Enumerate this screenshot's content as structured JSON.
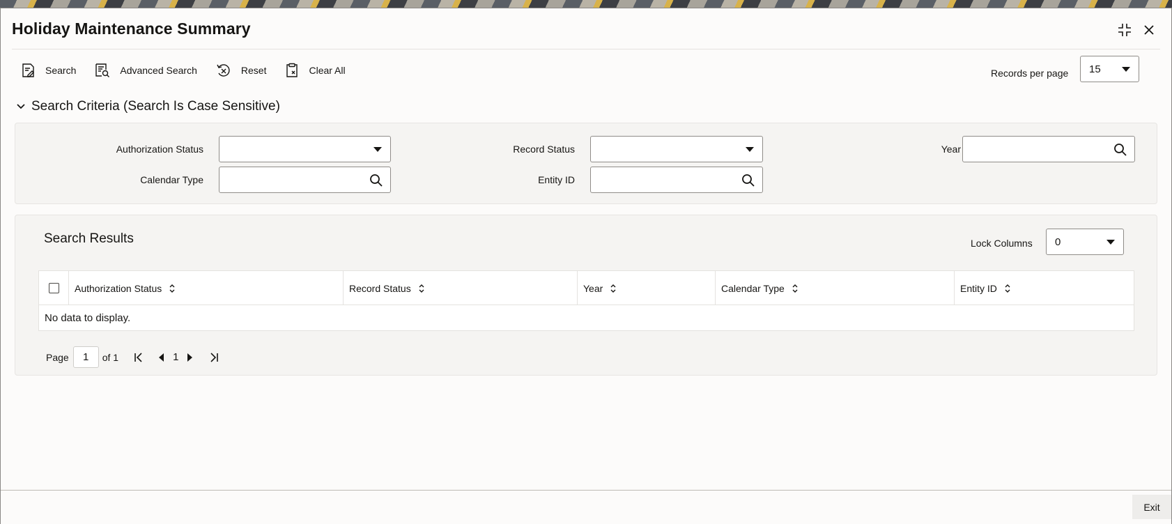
{
  "window": {
    "title": "Holiday Maintenance Summary"
  },
  "toolbar": {
    "search_label": "Search",
    "advanced_search_label": "Advanced Search",
    "reset_label": "Reset",
    "clear_all_label": "Clear All",
    "records_per_page_label": "Records per page",
    "records_per_page_value": "15"
  },
  "criteria": {
    "header": "Search Criteria (Search Is Case Sensitive)",
    "authorization_status_label": "Authorization Status",
    "authorization_status_value": "",
    "record_status_label": "Record Status",
    "record_status_value": "",
    "year_label": "Year",
    "calendar_type_label": "Calendar Type",
    "entity_id_label": "Entity ID"
  },
  "results": {
    "title": "Search Results",
    "lock_columns_label": "Lock Columns",
    "lock_columns_value": "0",
    "columns": [
      "Authorization Status",
      "Record Status",
      "Year",
      "Calendar Type",
      "Entity ID"
    ],
    "rows": [],
    "empty_message": "No data to display.",
    "pager": {
      "page_label": "Page",
      "current_page": "1",
      "of_label": "of 1",
      "page_number": "1"
    }
  },
  "footer": {
    "exit_label": "Exit"
  },
  "colors": {
    "text": "#161513",
    "panel": "#f5f4f2",
    "border": "#8f8c88"
  }
}
